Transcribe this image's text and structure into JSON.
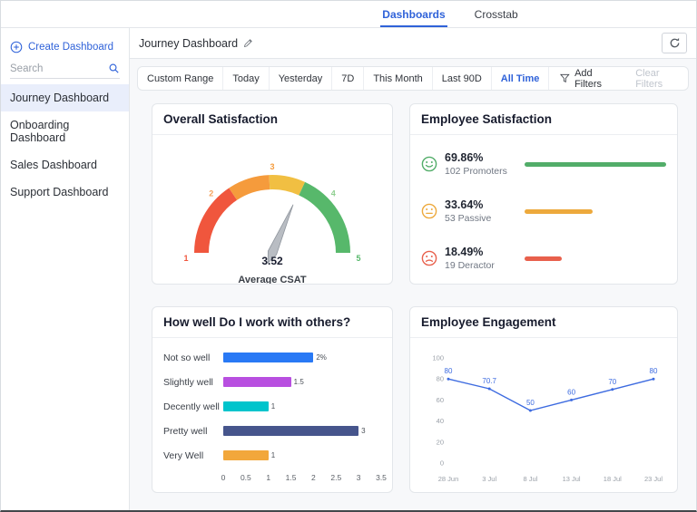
{
  "topbar": {
    "tabs": [
      {
        "label": "Dashboards",
        "active": true
      },
      {
        "label": "Crosstab",
        "active": false
      }
    ]
  },
  "sidebar": {
    "create_button": "Create Dashboard",
    "search_placeholder": "Search",
    "items": [
      {
        "label": "Journey Dashboard",
        "selected": true
      },
      {
        "label": "Onboarding Dashboard",
        "selected": false
      },
      {
        "label": "Sales Dashboard",
        "selected": false
      },
      {
        "label": "Support Dashboard",
        "selected": false
      }
    ]
  },
  "header": {
    "title": "Journey Dashboard"
  },
  "filters": {
    "ranges": [
      "Custom Range",
      "Today",
      "Yesterday",
      "7D",
      "This Month",
      "Last 90D",
      "All Time"
    ],
    "active_range": "All Time",
    "add_filters": "Add Filters",
    "clear_filters": "Clear Filters"
  },
  "chart_data": [
    {
      "id": "gauge",
      "type": "gauge",
      "title": "Overall Satisfaction",
      "min": 1,
      "max": 5,
      "value": 3.52,
      "value_label": "3.52",
      "caption": "Average CSAT",
      "needle_color": "#b9bdc3",
      "segments": [
        {
          "from": 1,
          "to": 2.25,
          "color": "#f0563d"
        },
        {
          "from": 2.25,
          "to": 2.95,
          "color": "#f59b3c"
        },
        {
          "from": 2.95,
          "to": 3.55,
          "color": "#f1bf42"
        },
        {
          "from": 3.55,
          "to": 5,
          "color": "#57b86b"
        }
      ],
      "tick_labels": [
        {
          "value": 1,
          "color": "#f0563d"
        },
        {
          "value": 2,
          "color": "#f5a35c"
        },
        {
          "value": 3,
          "color": "#f59b3c"
        },
        {
          "value": 4,
          "color": "#8fcf90"
        },
        {
          "value": 5,
          "color": "#57b86b"
        }
      ]
    },
    {
      "id": "satisfaction",
      "type": "stat-list",
      "title": "Employee Satisfaction",
      "rows": [
        {
          "icon": "smile",
          "color": "#52ad69",
          "pct": "69.86%",
          "value": 69.86,
          "label": "102 Promoters",
          "bar_color": "#52ad69"
        },
        {
          "icon": "neutral",
          "color": "#eda93c",
          "pct": "33.64%",
          "value": 33.64,
          "label": "53 Passive",
          "bar_color": "#eda93c"
        },
        {
          "icon": "frown",
          "color": "#e8604c",
          "pct": "18.49%",
          "value": 18.49,
          "label": "19 Deractor",
          "bar_color": "#e8604c"
        }
      ]
    },
    {
      "id": "hbar",
      "type": "bar",
      "title": "How well Do I work with others?",
      "categories": [
        "Not so well",
        "Slightly well",
        "Decently well",
        "Pretty well",
        "Very Well"
      ],
      "values": [
        2,
        1.5,
        1,
        3,
        1
      ],
      "value_labels": [
        "2%",
        "1.5",
        "1",
        "3",
        "1"
      ],
      "colors": [
        "#2979f5",
        "#b84fe0",
        "#00c4cc",
        "#46558c",
        "#f2a73b"
      ],
      "xlim": [
        0,
        3.5
      ],
      "x_ticks": [
        "0",
        "0.5",
        "1",
        "1.5",
        "2",
        "2.5",
        "3",
        "3.5"
      ]
    },
    {
      "id": "line",
      "type": "line",
      "title": "Employee Engagement",
      "x": [
        "28 Jun",
        "3 Jul",
        "8 Jul",
        "13 Jul",
        "18 Jul",
        "23 Jul"
      ],
      "values": [
        80,
        70.7,
        50,
        60,
        70,
        80
      ],
      "point_labels": [
        "80",
        "70.7",
        "50",
        "60",
        "70",
        "80"
      ],
      "ylim": [
        0,
        100
      ],
      "y_ticks": [
        0,
        20,
        40,
        60,
        80,
        100
      ],
      "line_color": "#3d6be0"
    }
  ]
}
